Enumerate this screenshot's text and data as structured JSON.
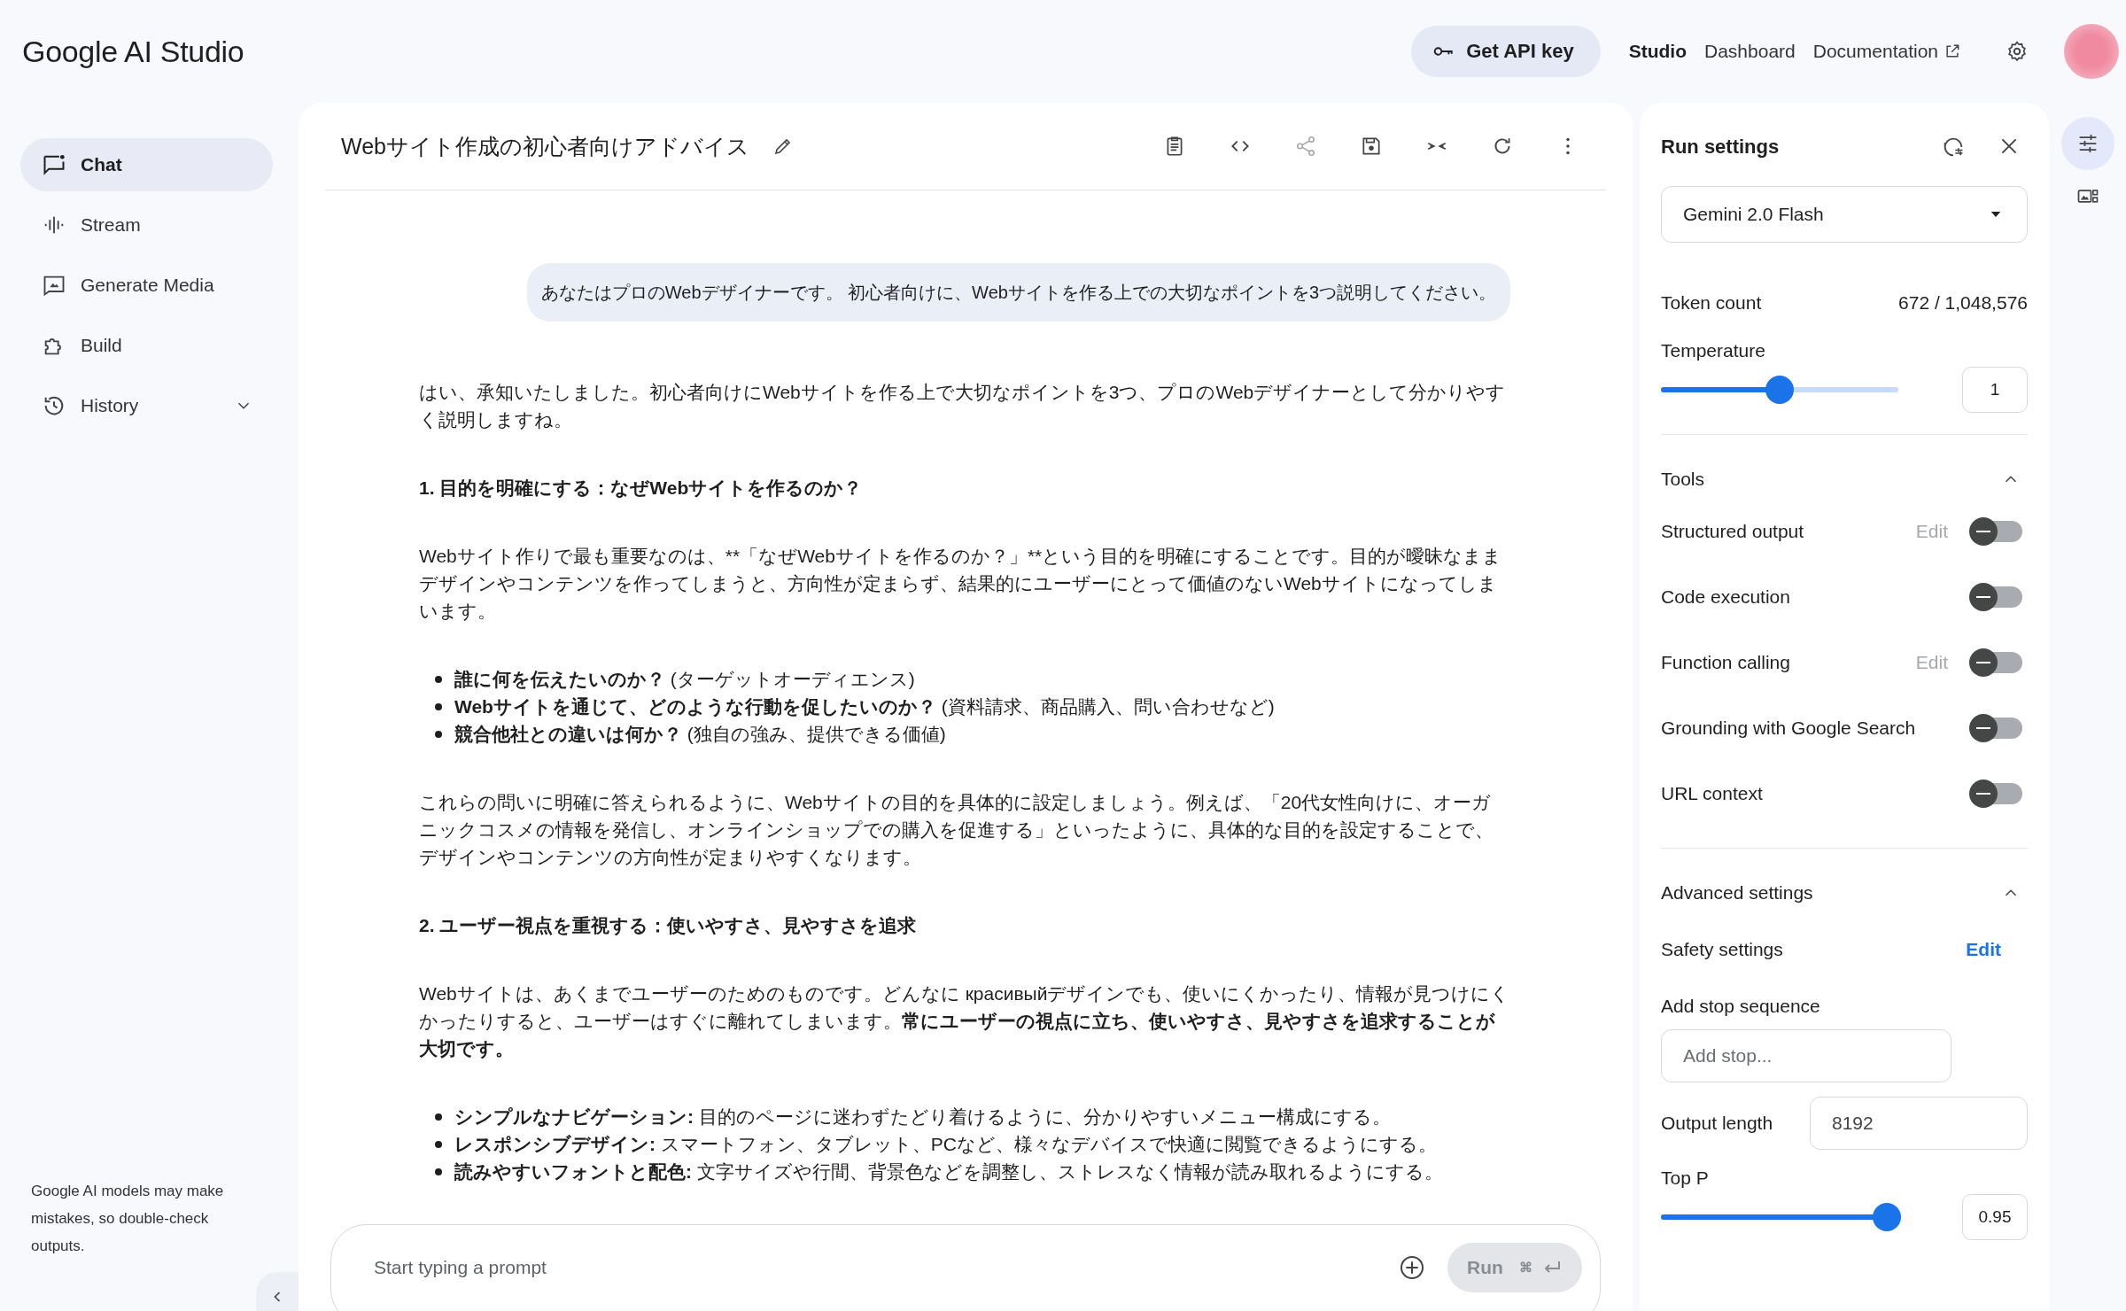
{
  "header": {
    "logo": "Google AI Studio",
    "api_button": "Get API key",
    "nav": [
      {
        "label": "Studio",
        "selected": true,
        "external": false
      },
      {
        "label": "Dashboard",
        "selected": false,
        "external": false
      },
      {
        "label": "Documentation",
        "selected": false,
        "external": true
      }
    ]
  },
  "sidebar": {
    "items": [
      {
        "label": "Chat",
        "kind": "chat",
        "selected": true,
        "expandable": false
      },
      {
        "label": "Stream",
        "kind": "stream",
        "selected": false,
        "expandable": false
      },
      {
        "label": "Generate Media",
        "kind": "media",
        "selected": false,
        "expandable": false
      },
      {
        "label": "Build",
        "kind": "build",
        "selected": false,
        "expandable": false
      },
      {
        "label": "History",
        "kind": "history",
        "selected": false,
        "expandable": true
      }
    ],
    "disclaimer": "Google AI models may make mistakes, so double-check outputs."
  },
  "chat": {
    "title": "Webサイト作成の初心者向けアドバイス",
    "user_message": "あなたはプロのWebデザイナーです。 初心者向けに、Webサイトを作る上での大切なポイントを3つ説明してください。",
    "blocks": [
      {
        "kind": "paragraph",
        "text": "はい、承知いたしました。初心者向けにWebサイトを作る上で大切なポイントを3つ、プロのWebデザイナーとして分かりやすく説明しますね。"
      },
      {
        "kind": "heading",
        "text": "1. 目的を明確にする：なぜWebサイトを作るのか？"
      },
      {
        "kind": "paragraph",
        "text": "Webサイト作りで最も重要なのは、**「なぜWebサイトを作るのか？」**という目的を明確にすることです。目的が曖昧なままデザインやコンテンツを作ってしまうと、方向性が定まらず、結果的にユーザーにとって価値のないWebサイトになってしまいます。"
      },
      {
        "kind": "list",
        "items": [
          "**誰に何を伝えたいのか？** (ターゲットオーディエンス)",
          "**Webサイトを通じて、どのような行動を促したいのか？** (資料請求、商品購入、問い合わせなど)",
          "**競合他社との違いは何か？** (独自の強み、提供できる価値)"
        ]
      },
      {
        "kind": "paragraph",
        "text": "これらの問いに明確に答えられるように、Webサイトの目的を具体的に設定しましょう。例えば、「20代女性向けに、オーガニックコスメの情報を発信し、オンラインショップでの購入を促進する」といったように、具体的な目的を設定することで、デザインやコンテンツの方向性が定まりやすくなります。"
      },
      {
        "kind": "heading",
        "text": "2. ユーザー視点を重視する：使いやすさ、見やすさを追求"
      },
      {
        "kind": "rich_paragraph",
        "text": "Webサイトは、あくまでユーザーのためのものです。どんなに красивыйデザインでも、使いにくかったり、情報が見つけにくかったりすると、ユーザーはすぐに離れてしまいます。**常にユーザーの視点に立ち、使いやすさ、見やすさを追求することが大切です。**"
      },
      {
        "kind": "list",
        "items": [
          "**シンプルなナビゲーション:** 目的のページに迷わずたどり着けるように、分かりやすいメニュー構成にする。",
          "**レスポンシブデザイン:** スマートフォン、タブレット、PCなど、様々なデバイスで快適に閲覧できるようにする。",
          "**読みやすいフォントと配色:** 文字サイズや行間、背景色などを調整し、ストレスなく情報が読み取れるようにする。"
        ]
      }
    ],
    "prompt": {
      "placeholder": "Start typing a prompt",
      "run_label": "Run",
      "shortcut": "⌘",
      "disabled": true
    }
  },
  "run_settings": {
    "title": "Run settings",
    "model": "Gemini 2.0 Flash",
    "token_label": "Token count",
    "token_value": "672 / 1,048,576",
    "temperature": {
      "label": "Temperature",
      "level": 0.5,
      "value": "1"
    },
    "tools": {
      "title": "Tools",
      "expanded": true,
      "items": [
        {
          "label": "Structured output",
          "edit": {
            "label": "Edit",
            "disabled": true
          },
          "on": false
        },
        {
          "label": "Code execution",
          "on": false
        },
        {
          "label": "Function calling",
          "edit": {
            "label": "Edit",
            "disabled": true
          },
          "on": false
        },
        {
          "label": "Grounding with Google Search",
          "on": false
        },
        {
          "label": "URL context",
          "on": false
        }
      ]
    },
    "advanced": {
      "title": "Advanced settings",
      "expanded": true,
      "safety": {
        "label": "Safety settings",
        "edit": "Edit"
      },
      "stop": {
        "label": "Add stop sequence",
        "placeholder": "Add stop..."
      },
      "output_length": {
        "label": "Output length",
        "value": "8192"
      },
      "top_p": {
        "label": "Top P",
        "level": 0.95,
        "value": "0.95"
      }
    }
  }
}
